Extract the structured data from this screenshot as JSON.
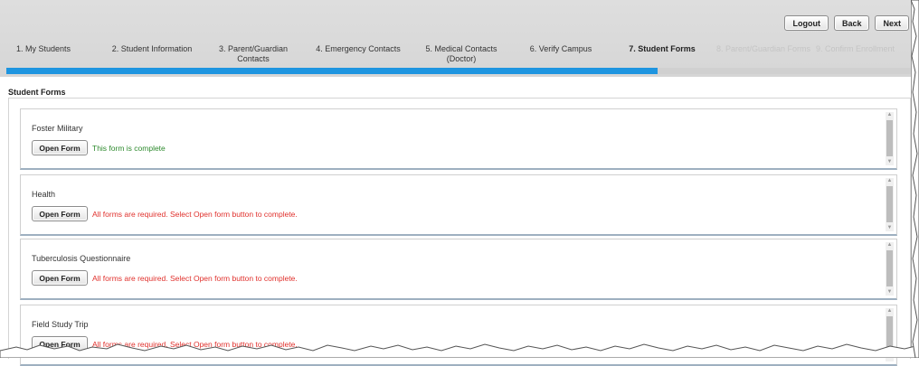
{
  "header": {
    "buttons": [
      {
        "label": "Logout"
      },
      {
        "label": "Back"
      },
      {
        "label": "Next"
      }
    ],
    "steps": [
      {
        "label": "1. My Students",
        "state": "done"
      },
      {
        "label": "2. Student Information",
        "state": "done"
      },
      {
        "label": "3. Parent/Guardian Contacts",
        "state": "done"
      },
      {
        "label": "4. Emergency Contacts",
        "state": "done"
      },
      {
        "label": "5. Medical Contacts (Doctor)",
        "state": "done"
      },
      {
        "label": "6. Verify Campus",
        "state": "done"
      },
      {
        "label": "7. Student Forms",
        "state": "active"
      },
      {
        "label": "8. Parent/Guardian Forms",
        "state": "disabled"
      },
      {
        "label": "9. Confirm Enrollment",
        "state": "disabled"
      }
    ],
    "progress_fraction": 0.72,
    "progress_color": "#1e95e0"
  },
  "section": {
    "title": "Student Forms"
  },
  "forms": [
    {
      "name": "Foster Military",
      "button": "Open Form",
      "status": "This form is complete",
      "status_type": "complete"
    },
    {
      "name": "Health",
      "button": "Open Form",
      "status": "All forms are required. Select Open form button to complete.",
      "status_type": "required"
    },
    {
      "name": "Tuberculosis Questionnaire",
      "button": "Open Form",
      "status": "All forms are required. Select Open form button to complete.",
      "status_type": "required"
    },
    {
      "name": "Field Study Trip",
      "button": "Open Form",
      "status": "All forms are required. Select Open form button to complete.",
      "status_type": "required"
    }
  ],
  "colors": {
    "complete": "#2d8a2d",
    "required": "#e0302c"
  }
}
